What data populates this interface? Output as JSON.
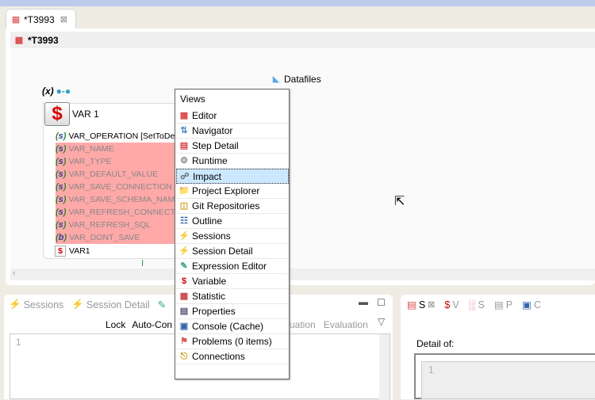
{
  "editor_tab": {
    "title": "*T3993"
  },
  "header": {
    "title": "*T3993"
  },
  "canvas": {
    "datafiles_label": "Datafiles",
    "variable_marker": "(x)"
  },
  "variable": {
    "name": "VAR 1",
    "footer": "VAR1",
    "rows": [
      {
        "type": "s",
        "label": "VAR_OPERATION [SetToDefault]",
        "highlighted": false
      },
      {
        "type": "s",
        "label": "VAR_NAME",
        "highlighted": true
      },
      {
        "type": "s",
        "label": "VAR_TYPE",
        "highlighted": true
      },
      {
        "type": "s",
        "label": "VAR_DEFAULT_VALUE",
        "highlighted": true
      },
      {
        "type": "s",
        "label": "VAR_SAVE_CONNECTION",
        "highlighted": true
      },
      {
        "type": "s",
        "label": "VAR_SAVE_SCHEMA_NAME",
        "highlighted": true
      },
      {
        "type": "s",
        "label": "VAR_REFRESH_CONNECTION",
        "highlighted": true
      },
      {
        "type": "s",
        "label": "VAR_REFRESH_SQL",
        "highlighted": true
      },
      {
        "type": "b",
        "label": "VAR_DONT_SAVE",
        "highlighted": true
      }
    ]
  },
  "menu": {
    "heading": "Views",
    "items": [
      {
        "label": "Editor",
        "icon": "editor-icon"
      },
      {
        "label": "Navigator",
        "icon": "navigator-icon"
      },
      {
        "label": "Step Detail",
        "icon": "step-detail-icon"
      },
      {
        "label": "Runtime",
        "icon": "gear-icon"
      },
      {
        "label": "Impact",
        "icon": "impact-icon",
        "selected": true
      },
      {
        "label": "Project Explorer",
        "icon": "folder-icon"
      },
      {
        "label": "Git Repositories",
        "icon": "git-icon"
      },
      {
        "label": "Outline",
        "icon": "outline-icon"
      },
      {
        "label": "Sessions",
        "icon": "lightning-icon"
      },
      {
        "label": "Session Detail",
        "icon": "session-detail-icon"
      },
      {
        "label": "Expression Editor",
        "icon": "pencil-icon"
      },
      {
        "label": "Variable",
        "icon": "dollar-icon"
      },
      {
        "label": "Statistic",
        "icon": "chart-icon"
      },
      {
        "label": "Properties",
        "icon": "table-icon"
      },
      {
        "label": "Console (Cache)",
        "icon": "monitor-icon"
      },
      {
        "label": "Problems (0 items)",
        "icon": "problems-icon"
      },
      {
        "label": "Connections",
        "icon": "plug-icon"
      }
    ]
  },
  "bottom_left": {
    "tabs": [
      "Sessions",
      "Session Detail"
    ],
    "toolbar": [
      "Lock",
      "Auto-Con",
      "uation",
      "Evaluation"
    ],
    "line_number": "1"
  },
  "bottom_right": {
    "tabs": [
      "S",
      "V",
      "S",
      "P",
      "C"
    ],
    "detail_label": "Detail of:",
    "line_number": "1"
  },
  "colors": {
    "highlight_row": "#ffa8a8",
    "selected_menu": "#cce8ff",
    "accent_red": "#d00000"
  }
}
